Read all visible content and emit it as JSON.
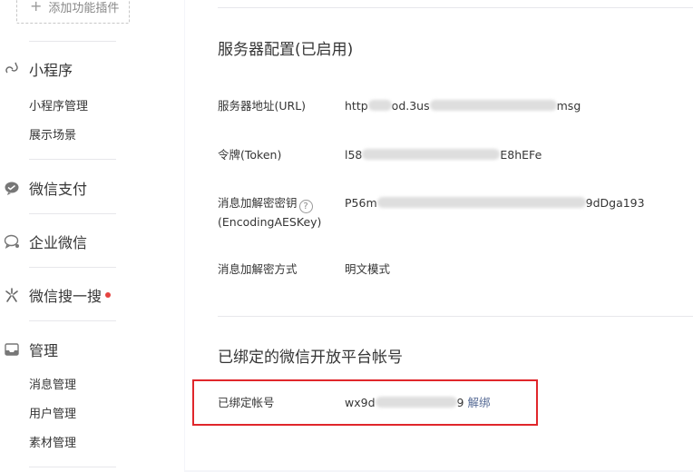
{
  "sidebar": {
    "add_plugin": "添加功能插件",
    "sections": [
      {
        "title": "小程序",
        "icon": "link-icon",
        "items": [
          "小程序管理",
          "展示场景"
        ]
      },
      {
        "title": "微信支付",
        "icon": "wechat-pay-icon",
        "items": []
      },
      {
        "title": "企业微信",
        "icon": "enterprise-wechat-icon",
        "items": []
      },
      {
        "title": "微信搜一搜",
        "icon": "sou-yi-sou-icon",
        "badge_color": "#e64340",
        "items": []
      },
      {
        "title": "管理",
        "icon": "inbox-icon",
        "items": [
          "消息管理",
          "用户管理",
          "素材管理"
        ]
      }
    ]
  },
  "server_config": {
    "title": "服务器配置(已启用)",
    "rows": [
      {
        "label": "服务器地址(URL)",
        "value_start": "http",
        "value_mid": "od.3us",
        "value_end": "msg"
      },
      {
        "label": "令牌(Token)",
        "value_start": "l58",
        "value_end": "E8hEFe"
      },
      {
        "label": "消息加解密密钥",
        "label2": "(EncodingAESKey)",
        "help": "?",
        "value_start": "P56m",
        "value_end": "9dDga193"
      },
      {
        "label": "消息加解密方式",
        "value": "明文模式"
      }
    ]
  },
  "open_platform": {
    "title": "已绑定的微信开放平台帐号",
    "label": "已绑定帐号",
    "value_start": "wx9d",
    "value_end": "9",
    "unbind": "解绑"
  },
  "colors": {
    "link": "#576b95",
    "highlight": "#e0262b",
    "badge": "#e64340"
  }
}
